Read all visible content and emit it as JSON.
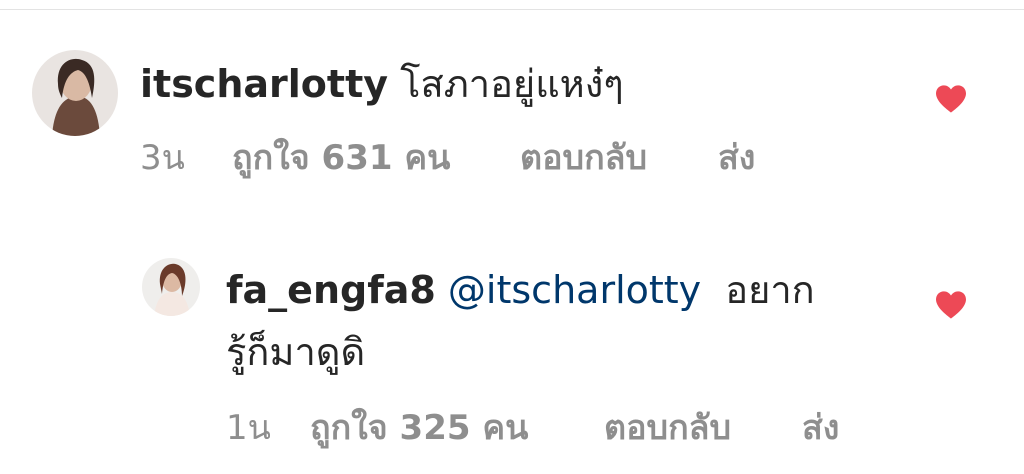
{
  "colors": {
    "text": "#262626",
    "meta": "#8e8e8e",
    "mention": "#00376b",
    "heart": "#ed4956"
  },
  "comments": [
    {
      "username": "itscharlotty",
      "text": "โสภาอยู่แหง๋ๆ",
      "time": "3น",
      "likes": "ถูกใจ 631 คน",
      "reply_label": "ตอบกลับ",
      "send_label": "ส่ง",
      "liked": true,
      "avatar_icon": "profile-photo"
    },
    {
      "username": "fa_engfa8",
      "mention": "@itscharlotty",
      "text_line1": "อยาก",
      "text_line2": "รู้ก็มาดูดิ",
      "time": "1น",
      "likes": "ถูกใจ 325 คน",
      "reply_label": "ตอบกลับ",
      "send_label": "ส่ง",
      "liked": true,
      "avatar_icon": "profile-photo"
    }
  ]
}
